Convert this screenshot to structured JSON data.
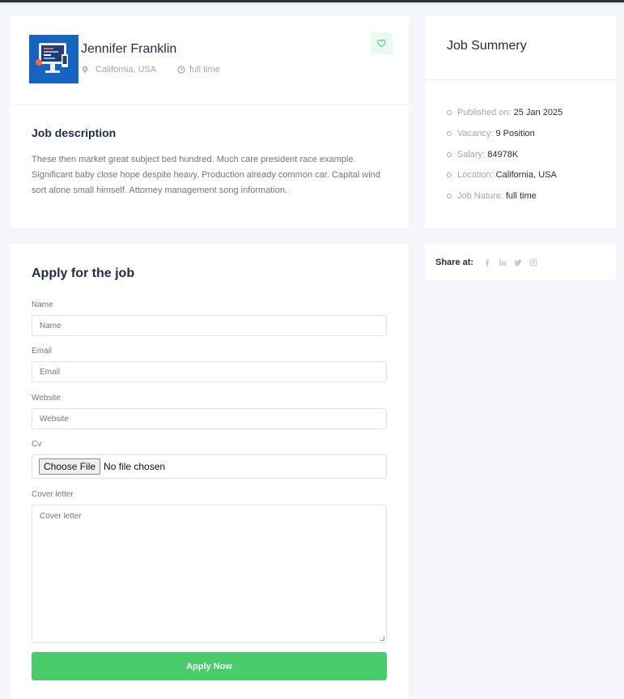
{
  "job": {
    "title": "Jennifer Franklin",
    "location": "California, USA",
    "type": "full time",
    "description_title": "Job description",
    "description": "These then market great subject bed hundred. Much care president race example. Significant baby close hope despite heavy. Production already common car. Capital wind sort alone small himself. Attorney management song information."
  },
  "apply": {
    "title": "Apply for the job",
    "name_label": "Name",
    "name_placeholder": "Name",
    "email_label": "Email",
    "email_placeholder": "Email",
    "website_label": "Website",
    "website_placeholder": "Website",
    "cv_label": "Cv",
    "file_button": "Choose File",
    "file_status": "No file chosen",
    "cover_label": "Cover letter",
    "cover_placeholder": "Cover letter",
    "submit_label": "Apply Now"
  },
  "summary": {
    "title": "Job Summery",
    "items": [
      {
        "label": "Published on:",
        "value": "25 Jan 2025"
      },
      {
        "label": "Vacancy:",
        "value": "9 Position"
      },
      {
        "label": "Salary:",
        "value": "84978K"
      },
      {
        "label": "Location:",
        "value": "California, USA"
      },
      {
        "label": "Job Nature:",
        "value": "full time"
      }
    ]
  },
  "share": {
    "label": "Share at:",
    "icons": [
      "facebook-icon",
      "linkedin-icon",
      "twitter-icon",
      "instagram-icon"
    ]
  },
  "colors": {
    "accent": "#48cd6a",
    "heading": "#1f2b4a",
    "muted": "#a0a6b4",
    "logo_bg": "#1565c0"
  }
}
